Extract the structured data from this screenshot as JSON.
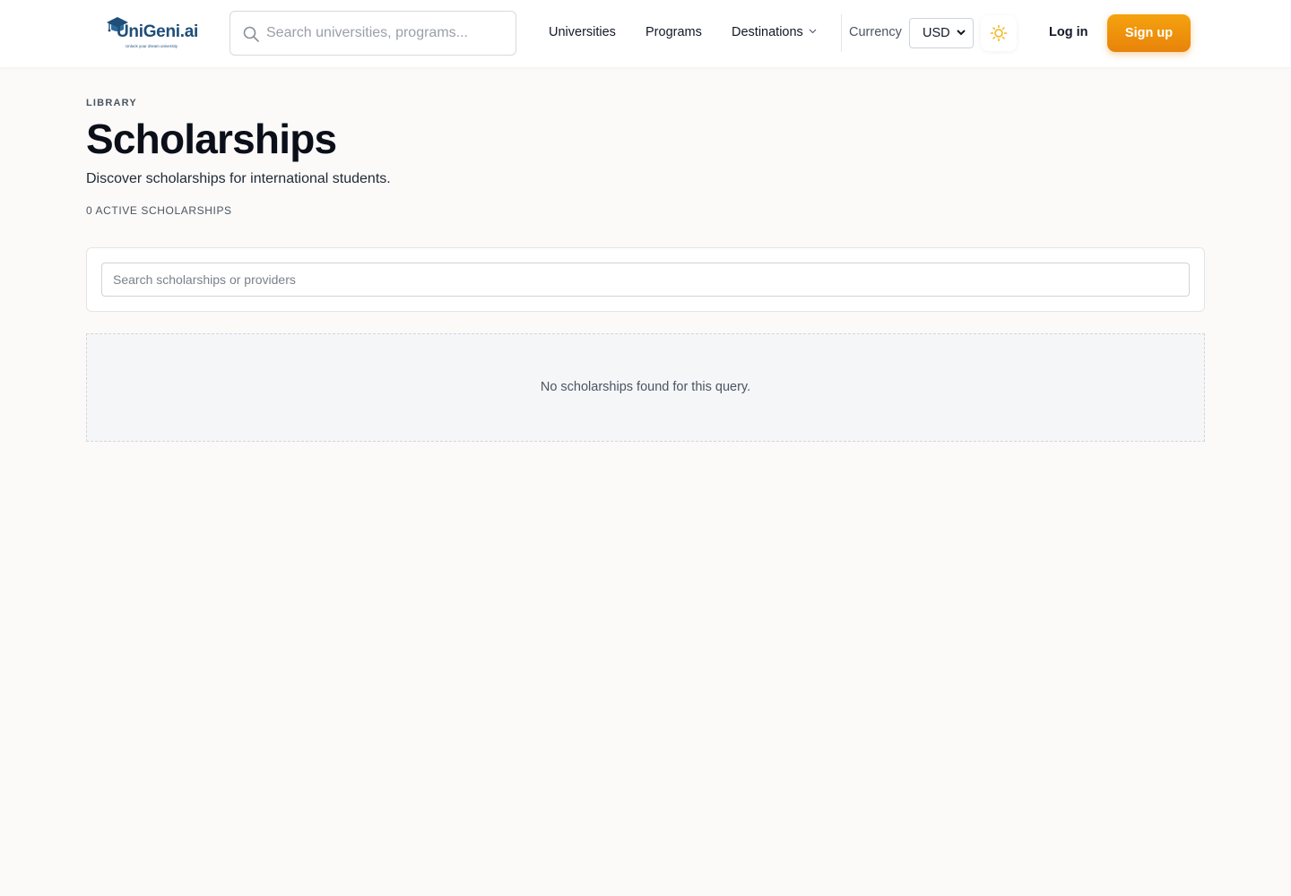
{
  "header": {
    "logo": {
      "name": "UniGeni.ai",
      "tagline": "Unlock your dream university"
    },
    "search": {
      "placeholder": "Search universities, programs..."
    },
    "nav": {
      "universities": "Universities",
      "programs": "Programs",
      "destinations": "Destinations"
    },
    "currency": {
      "label": "Currency",
      "selected": "USD"
    },
    "login_label": "Log in",
    "signup_label": "Sign up"
  },
  "page": {
    "eyebrow": "LIBRARY",
    "title": "Scholarships",
    "subtitle": "Discover scholarships for international students.",
    "count_text": "0 ACTIVE SCHOLARSHIPS"
  },
  "filter": {
    "placeholder": "Search scholarships or providers"
  },
  "empty_state": {
    "message": "No scholarships found for this query."
  },
  "icons": {
    "logo_cap": "graduation-cap-icon",
    "search": "search-icon",
    "destinations_chevron": "chevron-down-icon",
    "currency_chevron": "chevron-down-icon",
    "theme": "sun-icon"
  },
  "colors": {
    "brand_navy": "#1f4e79",
    "accent_orange": "#f29a0e",
    "sun_yellow": "#f2b31a",
    "page_background": "#fbfaf8"
  }
}
